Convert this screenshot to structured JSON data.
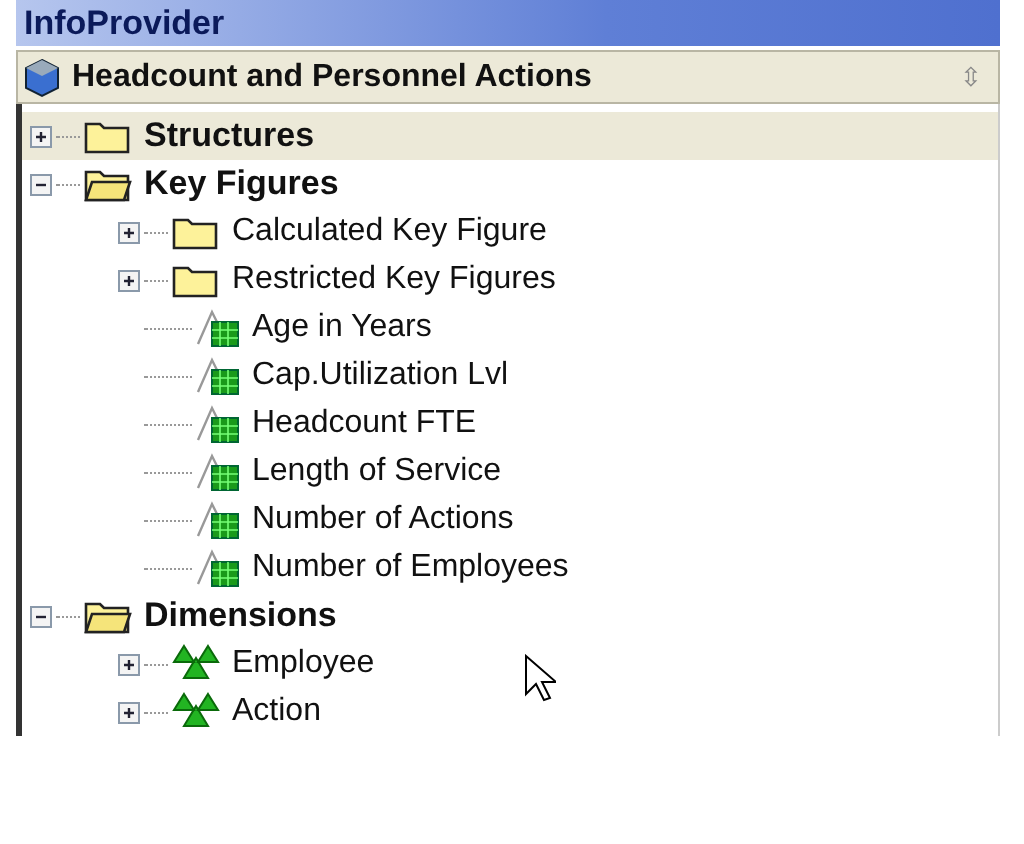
{
  "panel": {
    "title": "InfoProvider"
  },
  "provider": {
    "name": "Headcount and Personnel Actions",
    "sort_arrows": "⇳"
  },
  "tree": [
    {
      "label": "Structures",
      "kind": "folder",
      "expanded": false,
      "selected": true
    },
    {
      "label": "Key Figures",
      "kind": "folder",
      "expanded": true,
      "selected": false,
      "children": [
        {
          "label": "Calculated Key Figure",
          "kind": "folder",
          "expanded": false,
          "selected": false
        },
        {
          "label": "Restricted Key Figures",
          "kind": "folder",
          "expanded": false,
          "selected": false
        },
        {
          "label": "Age in Years",
          "kind": "key_figure",
          "selected": false
        },
        {
          "label": "Cap.Utilization Lvl",
          "kind": "key_figure",
          "selected": false
        },
        {
          "label": "Headcount FTE",
          "kind": "key_figure",
          "selected": false
        },
        {
          "label": "Length of Service",
          "kind": "key_figure",
          "selected": false
        },
        {
          "label": "Number of Actions",
          "kind": "key_figure",
          "selected": false
        },
        {
          "label": "Number of Employees",
          "kind": "key_figure",
          "selected": false
        }
      ]
    },
    {
      "label": "Dimensions",
      "kind": "folder",
      "expanded": true,
      "selected": false,
      "children": [
        {
          "label": "Employee",
          "kind": "dimension",
          "expanded": false,
          "selected": false
        },
        {
          "label": "Action",
          "kind": "dimension",
          "expanded": false,
          "selected": false
        }
      ]
    }
  ]
}
